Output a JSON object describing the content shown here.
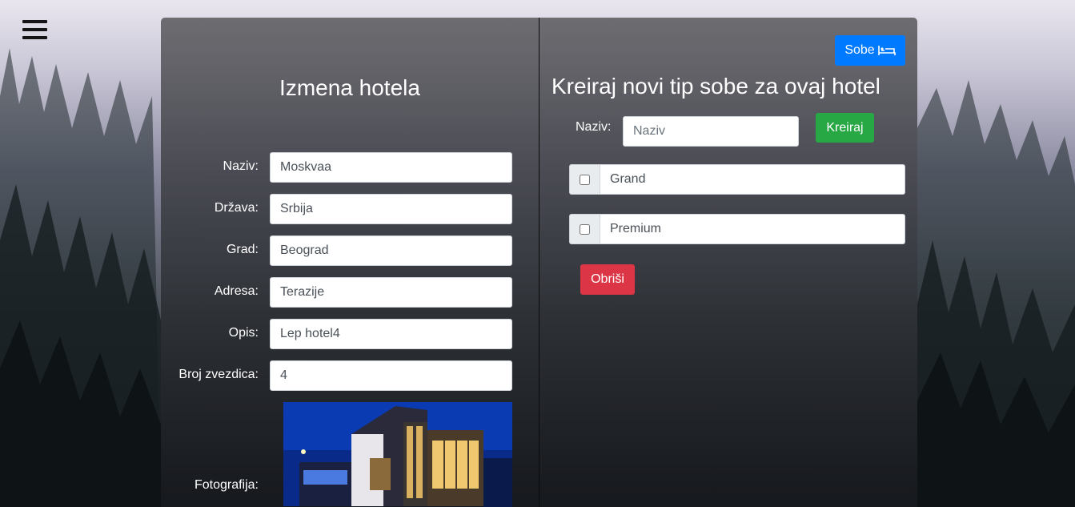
{
  "menu_icon": "hamburger-icon",
  "left": {
    "title": "Izmena hotela",
    "fields": [
      {
        "label": "Naziv:",
        "value": "Moskvaa"
      },
      {
        "label": "Država:",
        "value": "Srbija"
      },
      {
        "label": "Grad:",
        "value": "Beograd"
      },
      {
        "label": "Adresa:",
        "value": "Terazije"
      },
      {
        "label": "Opis:",
        "value": "Lep hotel4"
      },
      {
        "label": "Broj zvezdica:",
        "value": "4"
      }
    ],
    "photo_label": "Fotografija:"
  },
  "right": {
    "rooms_button": "Sobe",
    "rooms_icon": "bed-icon",
    "title": "Kreiraj novi tip sobe za ovaj hotel",
    "name_label": "Naziv:",
    "name_placeholder": "Naziv",
    "create_button": "Kreiraj",
    "room_types": [
      "Grand",
      "Premium"
    ],
    "delete_button": "Obriši"
  },
  "colors": {
    "primary": "#007bff",
    "success": "#28a745",
    "danger": "#dc3545"
  }
}
